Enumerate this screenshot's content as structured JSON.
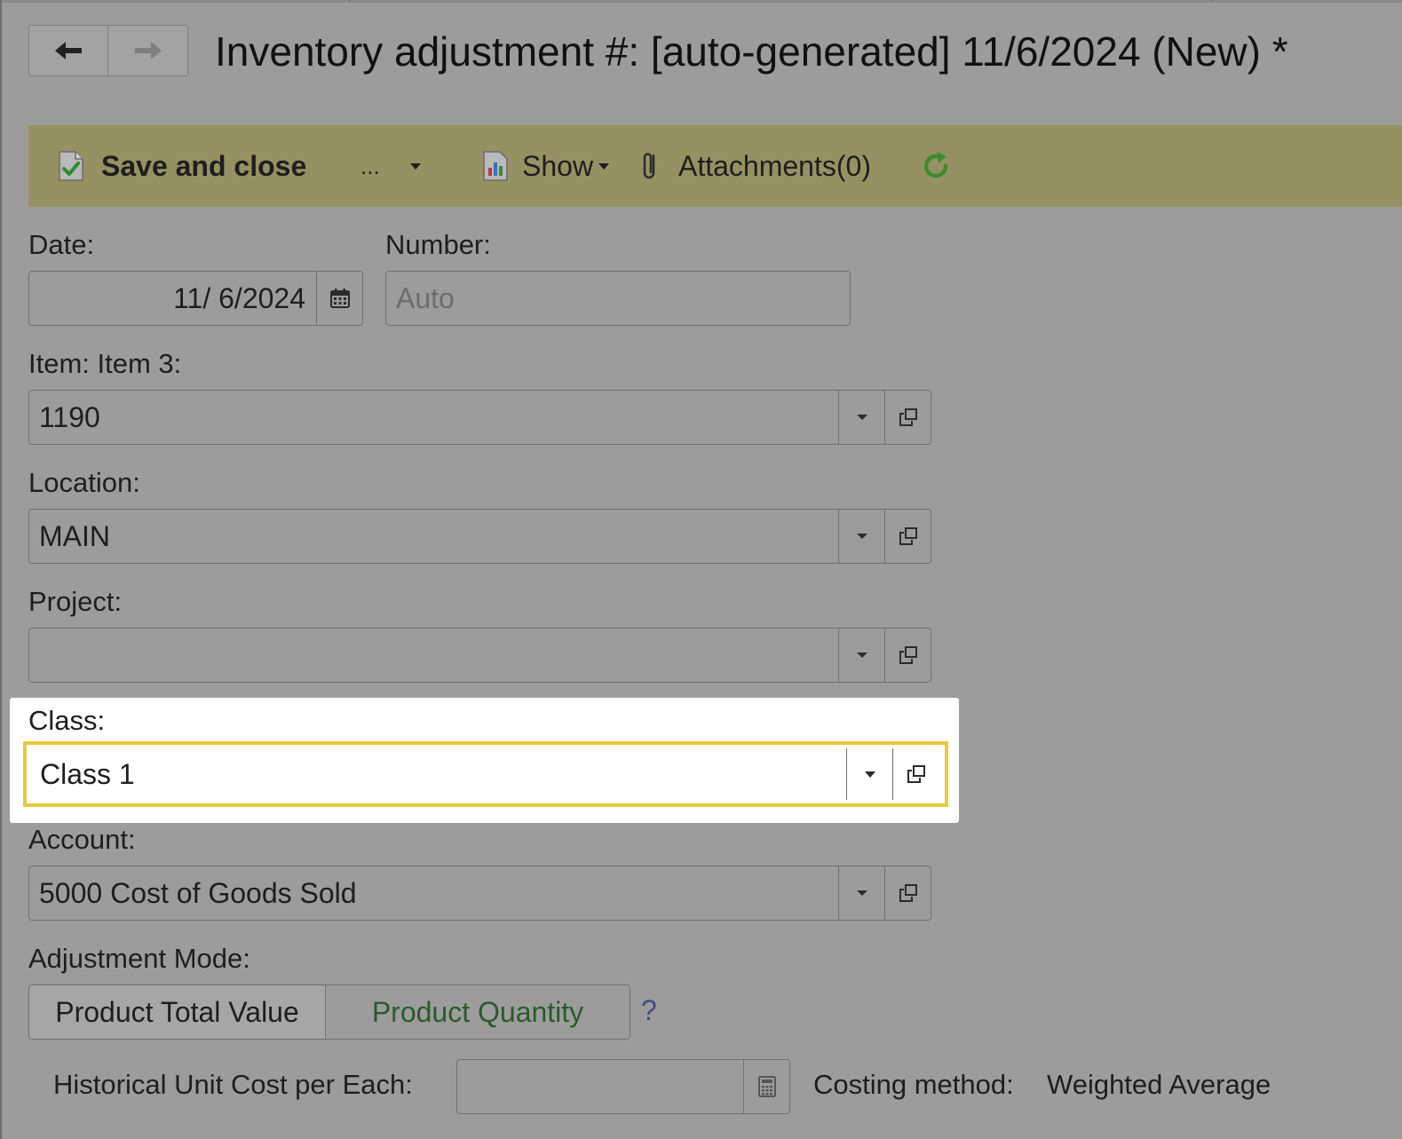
{
  "window": {
    "title": "Inventory adjustment #: [auto-generated] 11/6/2024 (New) *"
  },
  "nav": {
    "back_icon": "arrow-left-icon",
    "forward_icon": "arrow-right-icon"
  },
  "toolbar": {
    "save_label": "Save and close",
    "more_label": "...",
    "show_label": "Show",
    "attachments_label": "Attachments(0)",
    "refresh_icon": "refresh-icon",
    "accent_color": "#969162",
    "refresh_color": "#3c8c2c"
  },
  "form": {
    "date": {
      "label": "Date:",
      "value": "11/ 6/2024"
    },
    "number": {
      "label": "Number:",
      "placeholder": "Auto"
    },
    "item": {
      "label": "Item: Item 3:",
      "value": "1190"
    },
    "location": {
      "label": "Location:",
      "value": "MAIN"
    },
    "project": {
      "label": "Project:",
      "value": ""
    },
    "class": {
      "label": "Class:",
      "value": "Class 1",
      "highlight_color": "#e9c93d"
    },
    "account": {
      "label": "Account:",
      "value": "5000 Cost of Goods Sold"
    },
    "adjustment_mode": {
      "label": "Adjustment Mode:",
      "options": [
        "Product Total Value",
        "Product Quantity"
      ],
      "help": "?"
    },
    "historical_cost": {
      "label": "Historical Unit Cost per Each:",
      "value": ""
    },
    "costing_method": {
      "label": "Costing method:",
      "value": "Weighted Average"
    }
  }
}
